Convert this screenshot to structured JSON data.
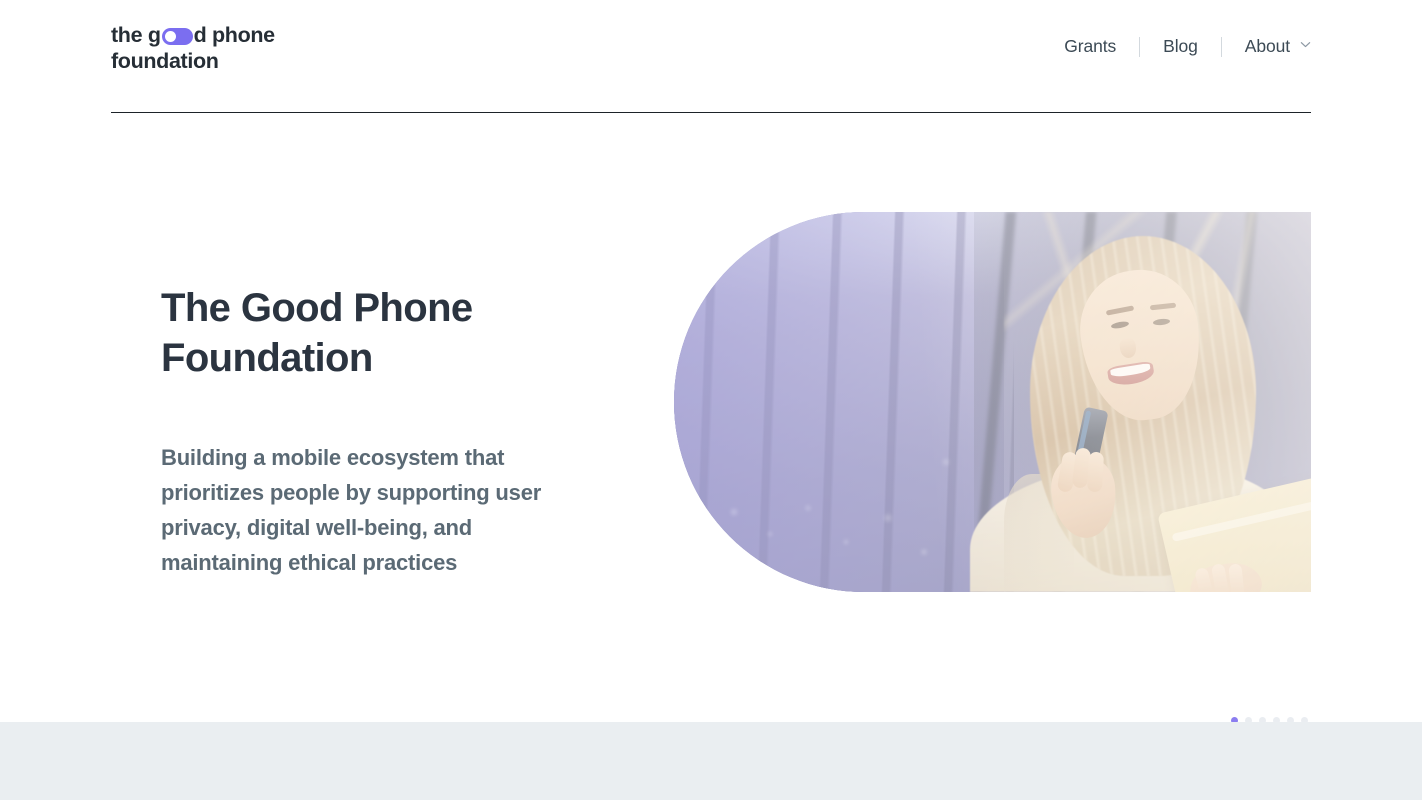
{
  "site": {
    "brand": {
      "name": "the good phone foundation",
      "line1_before": "the g",
      "line1_after": "d phone",
      "line2": "foundation",
      "toggle_icon": "toggle-switch-icon",
      "toggle_color": "#7b6ef0",
      "text_color": "#262e36"
    },
    "nav": {
      "items": [
        {
          "label": "Grants",
          "has_dropdown": false
        },
        {
          "label": "Blog",
          "has_dropdown": false
        },
        {
          "label": "About",
          "has_dropdown": true,
          "dropdown_icon": "chevron-down-icon"
        }
      ],
      "separator": "|",
      "text_color": "#3c4a55"
    }
  },
  "hero": {
    "title": "The Good Phone Foundation",
    "subtitle": "Building a mobile ecosystem that prioritizes people by supporting user privacy, digital well-being, and maintaining ethical practices",
    "title_color": "#2b3440",
    "subtitle_color": "#5b6a75",
    "media": {
      "alt": "Smiling woman with long blonde hair holding a mobile phone and a tablet outdoors",
      "tint_color": "#7a74c8",
      "shape": "half-rounded-left"
    },
    "carousel": {
      "total_slides": 6,
      "active_index": 0,
      "active_color": "#8b7df0",
      "inactive_color": "#eaedf1"
    }
  },
  "lower_section": {
    "background_color": "#eaeef1"
  }
}
